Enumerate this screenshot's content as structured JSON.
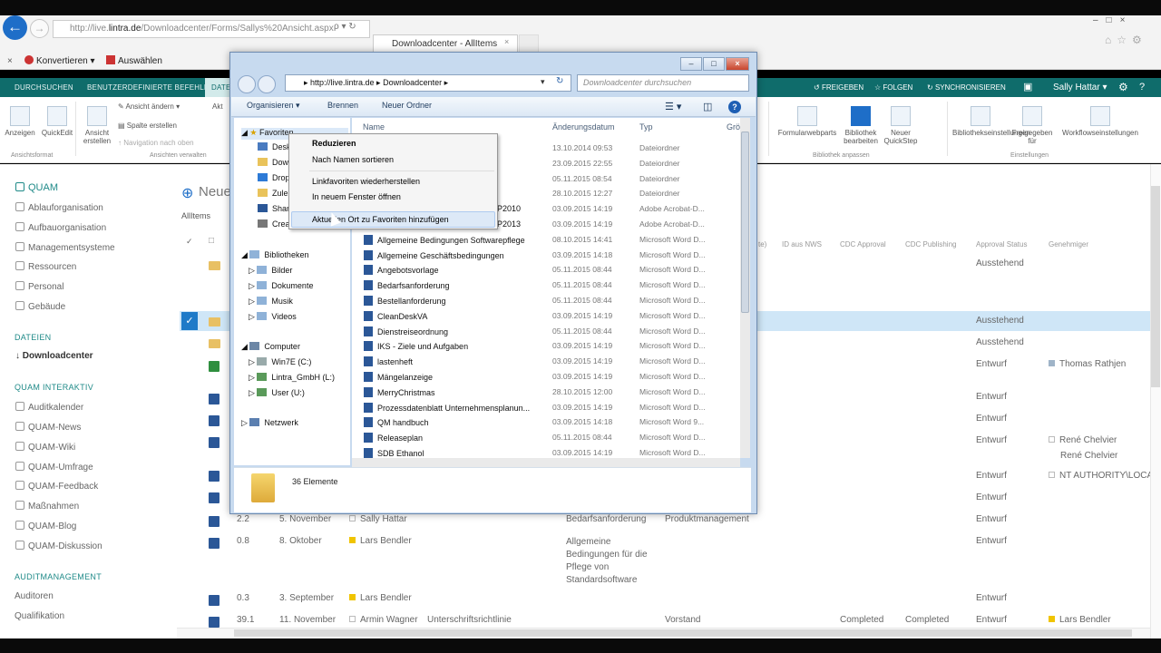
{
  "browser": {
    "address_prefix": "http://live.",
    "address_domain": "lintra.de",
    "address_rest": "/Downloadcenter/Forms/Sallys%20Ansicht.aspx",
    "address_controls": "ρ ▾ ↻",
    "tab_title": "Downloadcenter - AllItems",
    "tab_close": "×",
    "fav_konvertieren": "Konvertieren",
    "fav_auswaehlen": "Auswählen",
    "fav_close": "×",
    "window_controls": "–□×",
    "toolbar_icons": "⌂☆⚙"
  },
  "sharepoint": {
    "tabs": [
      "DURCHSUCHEN",
      "BENUTZERDEFINIERTE BEFEHLE",
      "DATE"
    ],
    "right": {
      "share": "FREIGEBEN",
      "follow": "FOLGEN",
      "sync": "SYNCHRONISIEREN",
      "user": "Sally Hattar ▾"
    },
    "ribbon": {
      "left_items": [
        "Anzeigen",
        "QuickEdit",
        "Ansicht erstellen"
      ],
      "small_items": [
        "Ansicht ändern",
        "Spalte erstellen",
        "Navigation nach oben"
      ],
      "right_items": [
        "Formularwebparts",
        "Bibliothek bearbeiten",
        "Neuer QuickStep",
        "Bibliothekseinstellungen",
        "Freigegeben für",
        "Workflowseinstellungen"
      ],
      "groups": [
        "Ansichtsformat",
        "Ansichten verwalten",
        "Bibliothek anpassen",
        "Einstellungen"
      ],
      "partial": "Akt"
    },
    "nav": {
      "items1": [
        "QUAM",
        "Ablauforganisation",
        "Aufbauorganisation",
        "Managementsysteme",
        "Ressourcen",
        "Personal",
        "Gebäude"
      ],
      "head_dateien": "DATEIEN",
      "downloadcenter": "Downloadcenter",
      "head_interaktiv": "QUAM INTERAKTIV",
      "items2": [
        "Auditkalender",
        "QUAM-News",
        "QUAM-Wiki",
        "QUAM-Umfrage",
        "QUAM-Feedback",
        "Maßnahmen",
        "QUAM-Blog",
        "QUAM-Diskussion"
      ],
      "head_audit": "AUDITMANAGEMENT",
      "items3": [
        "Auditoren",
        "Qualifikation"
      ]
    },
    "content": {
      "title": "Neue",
      "view": "AllItems",
      "headers": [
        "ID aus NWS",
        "CDC Approval",
        "CDC Publishing",
        "Approval Status",
        "Genehmiger"
      ],
      "partial_hdr": "te)",
      "rows": [
        {
          "status": "Ausstehend"
        },
        {
          "status": "Ausstehend"
        },
        {
          "status": "Ausstehend"
        },
        {
          "status": "Entwurf",
          "approver": "Thomas Rathjen"
        },
        {
          "status": "Entwurf"
        },
        {
          "status": "Entwurf"
        },
        {
          "status": "Entwurf",
          "approver": "René Chelvier",
          "approver2": "René Chelvier"
        },
        {
          "status": "Entwurf",
          "approver": "NT AUTHORITY\\LOCA"
        },
        {
          "status": "Entwurf"
        },
        {
          "status": "Entwurf"
        }
      ],
      "rows_visible": [
        {
          "ver": "2.2",
          "date": "5. November",
          "author": "Sally Hattar",
          "title": "Bedarfsanforderung",
          "dept": "Produktmanagement",
          "status": "Entwurf"
        },
        {
          "ver": "0.8",
          "date": "8. Oktober",
          "author": "Lars Bendler",
          "title": "Allgemeine Bedingungen für die Pflege von Standardsoftware",
          "status": "Entwurf"
        },
        {
          "ver": "0.3",
          "date": "3. September",
          "author": "Lars Bendler",
          "status": "Entwurf"
        },
        {
          "ver": "39.1",
          "date": "11. November",
          "author": "Armin Wagner",
          "title": "Unterschriftsrichtlinie",
          "dept": "Vorstand",
          "approval": "Completed",
          "publishing": "Completed",
          "status": "Entwurf",
          "approver": "Lars Bendler"
        }
      ]
    }
  },
  "explorer": {
    "address": "▸ http://live.lintra.de ▸ Downloadcenter ▸",
    "search_placeholder": "Downloadcenter durchsuchen",
    "toolbar": {
      "organize": "Organisieren ▾",
      "burn": "Brennen",
      "new_folder": "Neuer Ordner"
    },
    "columns": [
      "Name",
      "Änderungsdatum",
      "Typ",
      "Grö"
    ],
    "tree": {
      "favorites": "Favoriten",
      "fav_items": [
        "Desk",
        "Dow",
        "Drop",
        "Zule",
        "Shar",
        "Crea"
      ],
      "libraries": "Bibliotheken",
      "lib_items": [
        "Bilder",
        "Dokumente",
        "Musik",
        "Videos"
      ],
      "computer": "Computer",
      "drives": [
        "Win7E (C:)",
        "Lintra_GmbH (L:)",
        "User (U:)"
      ],
      "network": "Netzwerk"
    },
    "files": [
      {
        "name": "",
        "date": "13.10.2014 09:53",
        "type": "Dateiordner",
        "icon": "folder"
      },
      {
        "name": "",
        "date": "23.09.2015 22:55",
        "type": "Dateiordner",
        "icon": "folder"
      },
      {
        "name": "",
        "date": "05.11.2015 08:54",
        "type": "Dateiordner",
        "icon": "folder"
      },
      {
        "name": "",
        "date": "28.10.2015 12:27",
        "type": "Dateiordner",
        "icon": "folder"
      },
      {
        "name": "P2010",
        "date": "03.09.2015 14:19",
        "type": "Adobe Acrobat-D...",
        "icon": "pdf"
      },
      {
        "name": "P2013",
        "date": "03.09.2015 14:19",
        "type": "Adobe Acrobat-D...",
        "icon": "pdf"
      },
      {
        "name": "Allgemeine Bedingungen Softwarepflege",
        "date": "08.10.2015 14:41",
        "type": "Microsoft Word D...",
        "icon": "word"
      },
      {
        "name": "Allgemeine Geschäftsbedingungen",
        "date": "03.09.2015 14:18",
        "type": "Microsoft Word D...",
        "icon": "word"
      },
      {
        "name": "Angebotsvorlage",
        "date": "05.11.2015 08:44",
        "type": "Microsoft Word D...",
        "icon": "word"
      },
      {
        "name": "Bedarfsanforderung",
        "date": "05.11.2015 08:44",
        "type": "Microsoft Word D...",
        "icon": "word"
      },
      {
        "name": "Bestellanforderung",
        "date": "05.11.2015 08:44",
        "type": "Microsoft Word D...",
        "icon": "word"
      },
      {
        "name": "CleanDeskVA",
        "date": "03.09.2015 14:19",
        "type": "Microsoft Word D...",
        "icon": "word"
      },
      {
        "name": "Dienstreiseordnung",
        "date": "05.11.2015 08:44",
        "type": "Microsoft Word D...",
        "icon": "word"
      },
      {
        "name": "IKS - Ziele und Aufgaben",
        "date": "03.09.2015 14:19",
        "type": "Microsoft Word D...",
        "icon": "word"
      },
      {
        "name": "lastenheft",
        "date": "03.09.2015 14:19",
        "type": "Microsoft Word D...",
        "icon": "word"
      },
      {
        "name": "Mängelanzeige",
        "date": "03.09.2015 14:19",
        "type": "Microsoft Word D...",
        "icon": "word"
      },
      {
        "name": "MerryChristmas",
        "date": "28.10.2015 12:00",
        "type": "Microsoft Word D...",
        "icon": "word"
      },
      {
        "name": "Prozessdatenblatt Unternehmensplanun...",
        "date": "03.09.2015 14:19",
        "type": "Microsoft Word D...",
        "icon": "word"
      },
      {
        "name": "QM handbuch",
        "date": "03.09.2015 14:18",
        "type": "Microsoft Word 9...",
        "icon": "word"
      },
      {
        "name": "Releaseplan",
        "date": "05.11.2015 08:44",
        "type": "Microsoft Word D...",
        "icon": "word"
      },
      {
        "name": "SDB Ethanol",
        "date": "03.09.2015 14:19",
        "type": "Microsoft Word D...",
        "icon": "word"
      }
    ],
    "item_count": "36 Elemente",
    "context_menu": [
      "Reduzieren",
      "Nach Namen sortieren",
      "Linkfavoriten wiederherstellen",
      "In neuem Fenster öffnen",
      "Aktuellen Ort zu Favoriten hinzufügen"
    ]
  }
}
